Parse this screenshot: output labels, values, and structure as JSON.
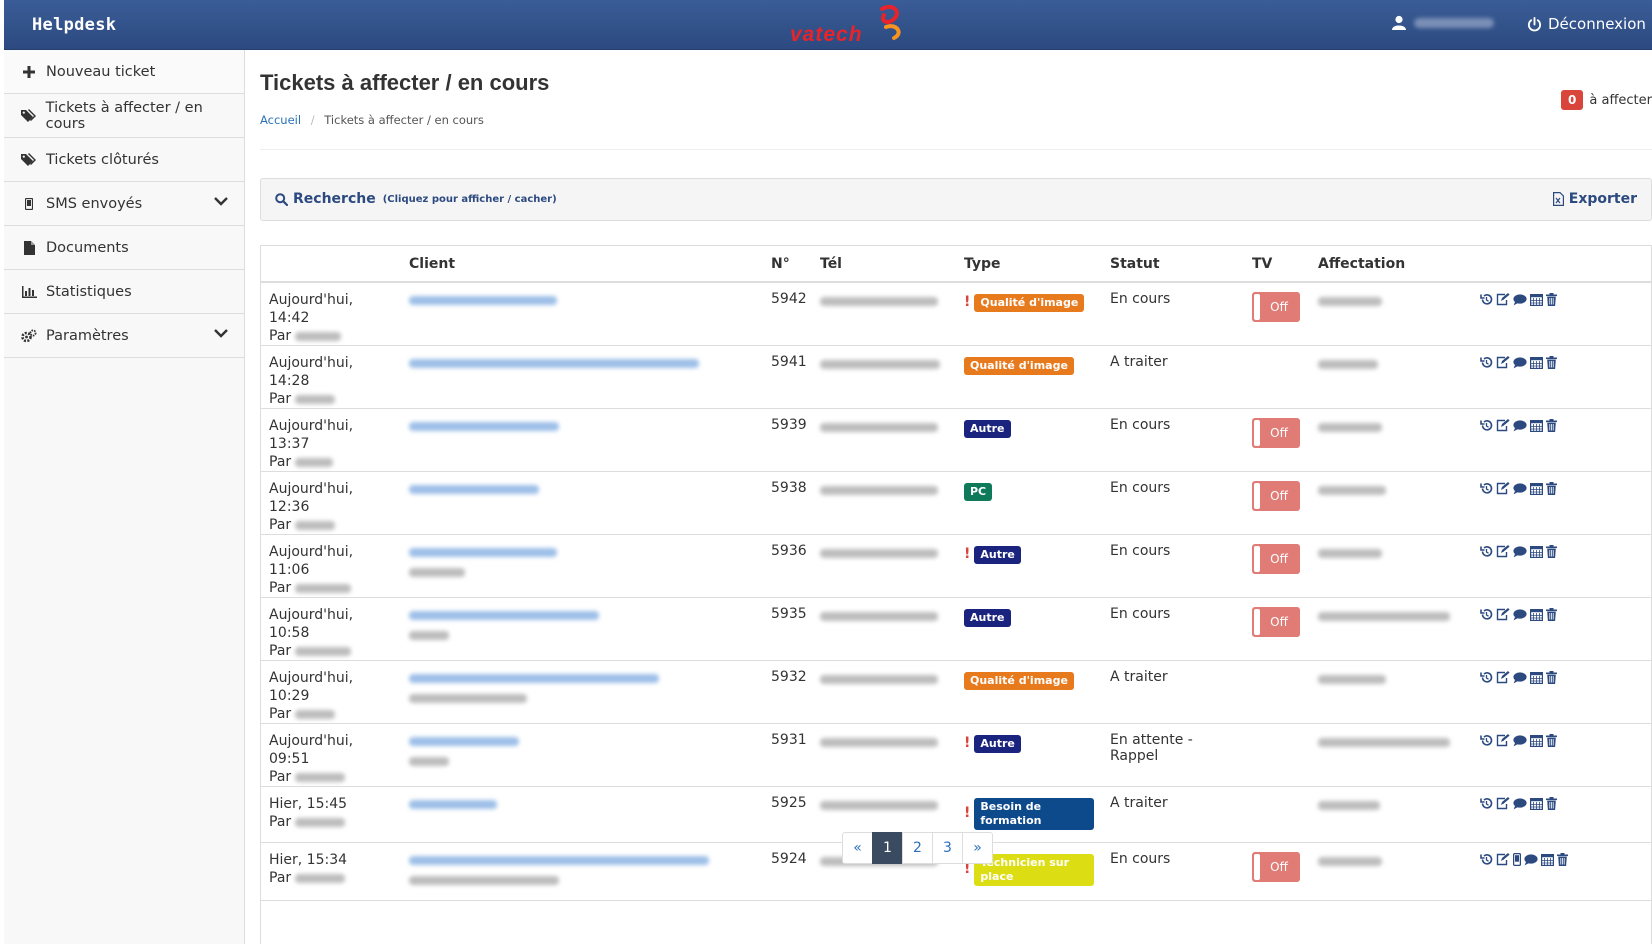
{
  "navbar": {
    "brand": "Helpdesk",
    "logo_text": "vatech",
    "logout_label": "Déconnexion"
  },
  "sidebar": {
    "items": [
      {
        "label": "Nouveau ticket",
        "icon": "plus-icon"
      },
      {
        "label": "Tickets à affecter / en cours",
        "icon": "tags-icon"
      },
      {
        "label": "Tickets clôturés",
        "icon": "tags-icon"
      },
      {
        "label": "SMS envoyés",
        "icon": "mobile-icon",
        "has_submenu": true
      },
      {
        "label": "Documents",
        "icon": "file-icon"
      },
      {
        "label": "Statistiques",
        "icon": "bar-chart-icon"
      },
      {
        "label": "Paramètres",
        "icon": "cogs-icon",
        "has_submenu": true
      }
    ]
  },
  "main": {
    "title": "Tickets à affecter / en cours",
    "breadcrumb": {
      "home": "Accueil",
      "current": "Tickets à affecter / en cours"
    },
    "to_assign": {
      "count": "0",
      "label": "à affecter"
    },
    "search": {
      "title": "Recherche",
      "subtitle": "(Cliquez pour afficher / cacher)",
      "export_label": "Exporter"
    }
  },
  "colors": {
    "navbar": "#2c4a80",
    "qualite": "#e87a1e",
    "autre": "#1a237e",
    "pc": "#0f7a5a",
    "formation": "#0d4a8c",
    "technicien": "#dddd14",
    "toggle_off": "#e07b76"
  },
  "table": {
    "headers": {
      "date": "",
      "client": "Client",
      "num": "N°",
      "tel": "Tél",
      "type": "Type",
      "status": "Statut",
      "tv": "TV",
      "assign": "Affectation"
    },
    "par_label": "Par",
    "tv_off_label": "Off",
    "rows": [
      {
        "date": "Aujourd'hui, 14:42",
        "num": "5942",
        "urgent": true,
        "type": "Qualité d'image",
        "type_key": "qualite",
        "status": "En cours",
        "tv": true
      },
      {
        "date": "Aujourd'hui, 14:28",
        "num": "5941",
        "urgent": false,
        "type": "Qualité d'image",
        "type_key": "qualite",
        "status": "A traiter",
        "tv": false
      },
      {
        "date": "Aujourd'hui, 13:37",
        "num": "5939",
        "urgent": false,
        "type": "Autre",
        "type_key": "autre",
        "status": "En cours",
        "tv": true
      },
      {
        "date": "Aujourd'hui, 12:36",
        "num": "5938",
        "urgent": false,
        "type": "PC",
        "type_key": "pc",
        "status": "En cours",
        "tv": true
      },
      {
        "date": "Aujourd'hui, 11:06",
        "num": "5936",
        "urgent": true,
        "type": "Autre",
        "type_key": "autre",
        "status": "En cours",
        "tv": true
      },
      {
        "date": "Aujourd'hui, 10:58",
        "num": "5935",
        "urgent": false,
        "type": "Autre",
        "type_key": "autre",
        "status": "En cours",
        "tv": true
      },
      {
        "date": "Aujourd'hui, 10:29",
        "num": "5932",
        "urgent": false,
        "type": "Qualité d'image",
        "type_key": "qualite",
        "status": "A traiter",
        "tv": false
      },
      {
        "date": "Aujourd'hui, 09:51",
        "num": "5931",
        "urgent": true,
        "type": "Autre",
        "type_key": "autre",
        "status": "En attente - Rappel",
        "tv": false
      },
      {
        "date": "Hier, 15:45",
        "num": "5925",
        "urgent": true,
        "type": "Besoin de formation",
        "type_key": "formation",
        "status": "A traiter",
        "tv": false
      },
      {
        "date": "Hier, 15:34",
        "num": "5924",
        "urgent": true,
        "type": "Technicien sur place",
        "type_key": "technicien",
        "status": "En cours",
        "tv": true,
        "extra_sms": true
      }
    ]
  },
  "pagination": {
    "prev": "«",
    "pages": [
      "1",
      "2",
      "3"
    ],
    "next": "»",
    "active": "1"
  }
}
